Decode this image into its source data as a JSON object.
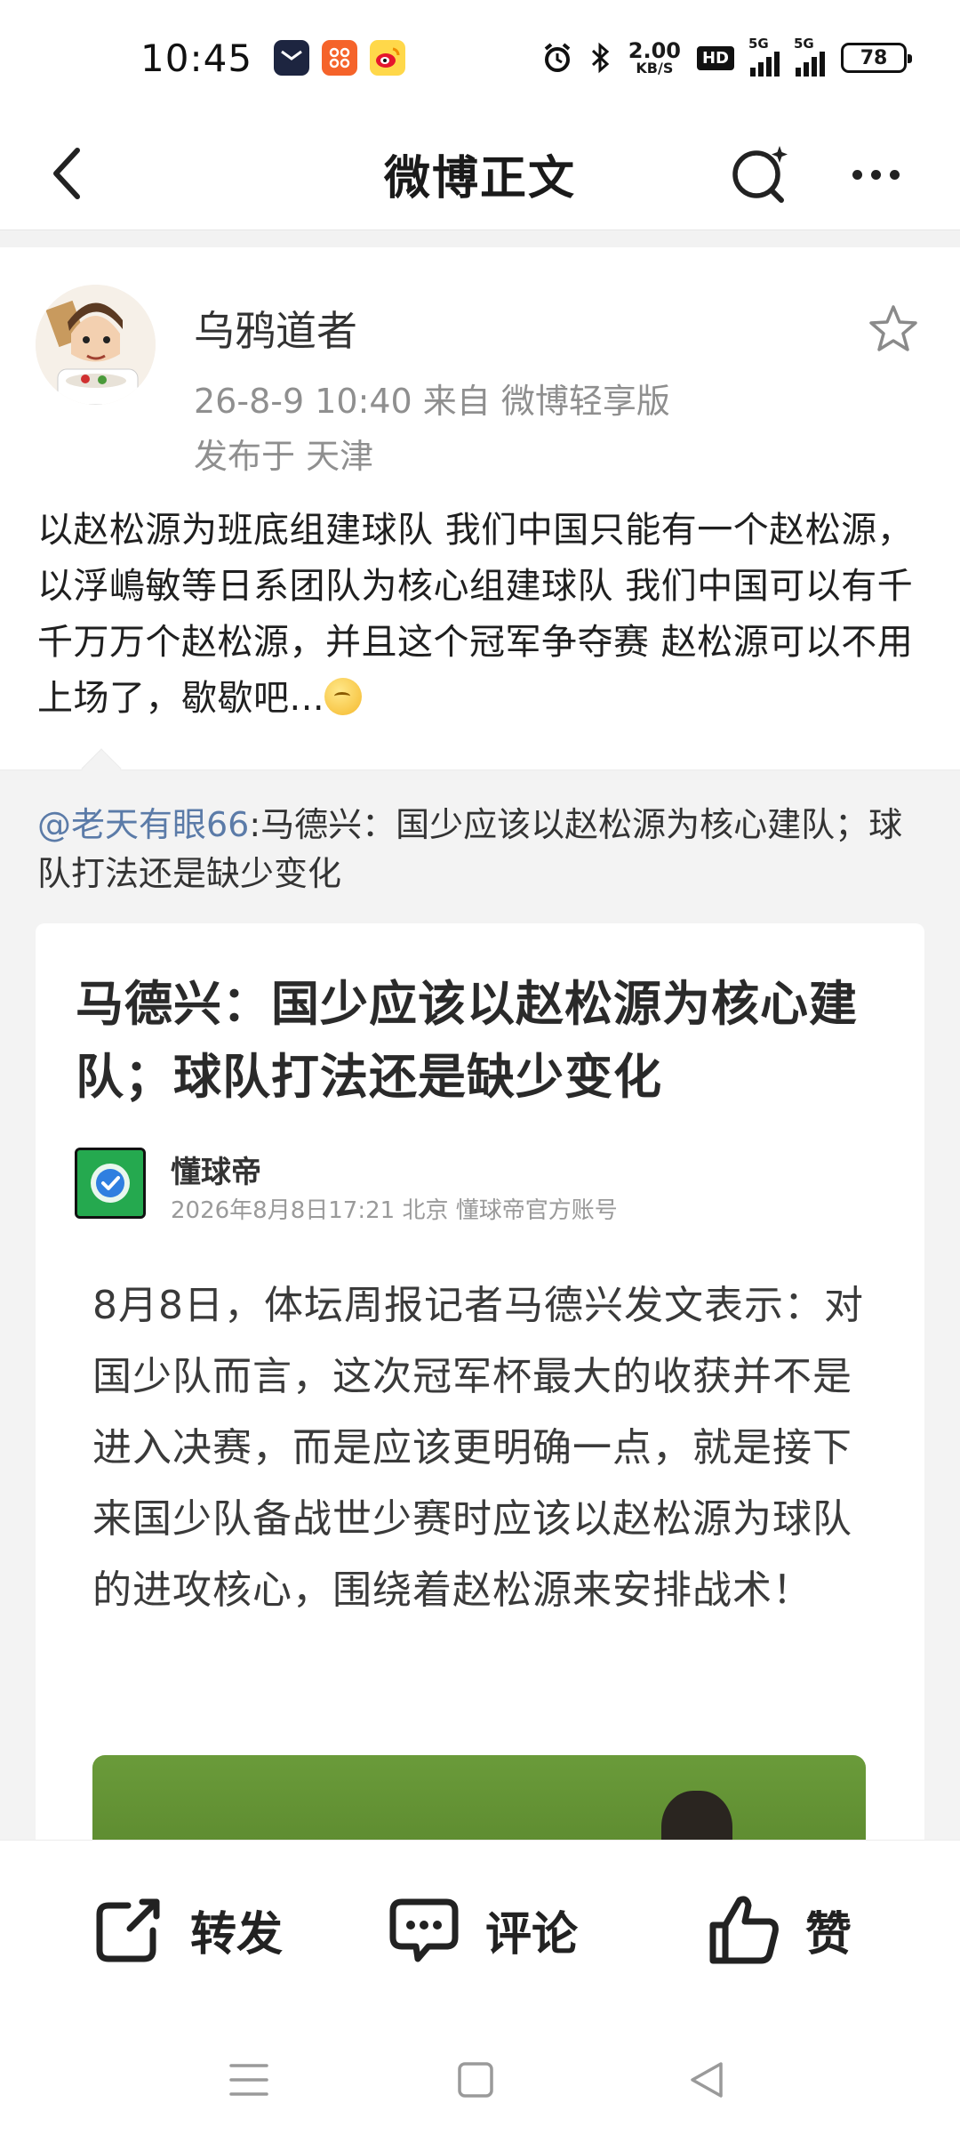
{
  "status_bar": {
    "time": "10:45",
    "net_speed_value": "2.00",
    "net_speed_unit": "KB/S",
    "hd_label": "HD",
    "signal1_label": "5G",
    "signal2_label": "5G",
    "battery": "78"
  },
  "nav": {
    "title": "微博正文"
  },
  "post": {
    "author": "乌鸦道者",
    "meta": "26-8-9 10:40   来自 微博轻享版",
    "location": "发布于 天津",
    "text": "以赵松源为班底组建球队 我们中国只能有一个赵松源，以浮嶋敏等日系团队为核心组建球队 我们中国可以有千千万万个赵松源，并且这个冠军争夺赛 赵松源可以不用上场了，歇歇吧..."
  },
  "repost": {
    "user": "@老天有眼66",
    "text": ":马德兴：国少应该以赵松源为核心建队；球队打法还是缺少变化",
    "card": {
      "title": "马德兴：国少应该以赵松源为核心建队；球队打法还是缺少变化",
      "source_name": "懂球帝",
      "source_meta": "2026年8月8日17:21 北京 懂球帝官方账号",
      "body": "8月8日，体坛周报记者马德兴发文表示：对国少队而言，这次冠军杯最大的收获并不是进入决赛，而是应该更明确一点，就是接下来国少队备战世少赛时应该以赵松源为球队的进攻核心，围绕着赵松源来安排战术！"
    }
  },
  "actions": {
    "repost_label": "转发",
    "comment_label": "评论",
    "like_label": "赞"
  }
}
